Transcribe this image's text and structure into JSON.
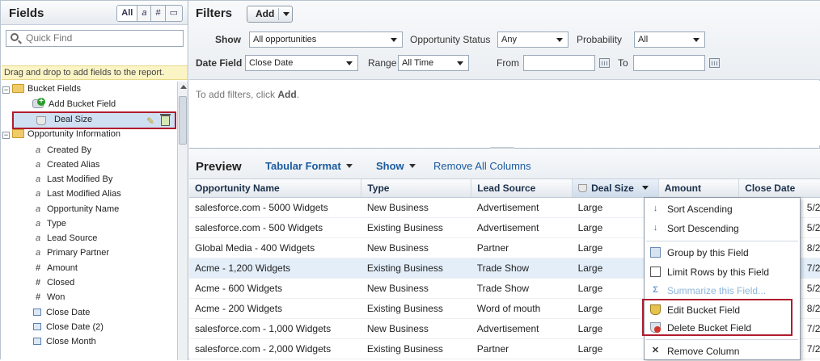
{
  "fields_panel": {
    "title": "Fields",
    "type_filters": [
      "All",
      "a",
      "#",
      "▭"
    ],
    "search_placeholder": "Quick Find",
    "tip": "Drag and drop to add fields to the report.",
    "tree": [
      {
        "kind": "folder",
        "label": "Bucket Fields",
        "level": 0
      },
      {
        "kind": "addbucket",
        "label": "Add Bucket Field",
        "level": 1
      },
      {
        "kind": "bucket",
        "label": "Deal Size",
        "level": 1,
        "selected": true
      },
      {
        "kind": "folder",
        "label": "Opportunity Information",
        "level": 0
      },
      {
        "kind": "text",
        "label": "Created By"
      },
      {
        "kind": "text",
        "label": "Created Alias"
      },
      {
        "kind": "text",
        "label": "Last Modified By"
      },
      {
        "kind": "text",
        "label": "Last Modified Alias"
      },
      {
        "kind": "text",
        "label": "Opportunity Name"
      },
      {
        "kind": "text",
        "label": "Type"
      },
      {
        "kind": "text",
        "label": "Lead Source"
      },
      {
        "kind": "text",
        "label": "Primary Partner"
      },
      {
        "kind": "num",
        "label": "Amount"
      },
      {
        "kind": "num",
        "label": "Closed"
      },
      {
        "kind": "num",
        "label": "Won"
      },
      {
        "kind": "date",
        "label": "Close Date"
      },
      {
        "kind": "date",
        "label": "Close Date (2)"
      },
      {
        "kind": "date",
        "label": "Close Month"
      }
    ]
  },
  "filters": {
    "title": "Filters",
    "add_label": "Add",
    "show_label": "Show",
    "show_value": "All opportunities",
    "status_label": "Opportunity Status",
    "status_value": "Any",
    "probability_label": "Probability",
    "probability_value": "All",
    "date_field_label": "Date Field",
    "date_field_value": "Close Date",
    "range_label": "Range",
    "range_value": "All Time",
    "from_label": "From",
    "to_label": "To",
    "hint_prefix": "To add filters, click ",
    "hint_bold": "Add",
    "hint_suffix": "."
  },
  "preview": {
    "title": "Preview",
    "format_label": "Tabular Format",
    "show_label": "Show",
    "remove_all_label": "Remove All Columns",
    "columns": [
      "Opportunity Name",
      "Type",
      "Lead Source",
      "Deal Size",
      "Amount",
      "Close Date"
    ],
    "rows": [
      [
        "salesforce.com - 5000 Widgets",
        "New Business",
        "Advertisement",
        "Large",
        "",
        "5/2"
      ],
      [
        "salesforce.com - 500 Widgets",
        "Existing Business",
        "Advertisement",
        "Large",
        "",
        "5/2"
      ],
      [
        "Global Media - 400 Widgets",
        "New Business",
        "Partner",
        "Large",
        "",
        "8/2"
      ],
      [
        "Acme - 1,200 Widgets",
        "Existing Business",
        "Trade Show",
        "Large",
        "",
        "7/2"
      ],
      [
        "Acme - 600 Widgets",
        "New Business",
        "Trade Show",
        "Large",
        "",
        "5/2"
      ],
      [
        "Acme - 200 Widgets",
        "Existing Business",
        "Word of mouth",
        "Large",
        "",
        "8/2"
      ],
      [
        "salesforce.com - 1,000 Widgets",
        "New Business",
        "Advertisement",
        "Large",
        "",
        "7/2"
      ],
      [
        "salesforce.com - 2,000 Widgets",
        "Existing Business",
        "Partner",
        "Large",
        "",
        "7/2"
      ]
    ]
  },
  "context_menu": {
    "items": [
      {
        "label": "Sort Ascending",
        "icon": "sort-ascending-icon"
      },
      {
        "label": "Sort Descending",
        "icon": "sort-descending-icon"
      },
      {
        "label": "Group by this Field",
        "icon": "group-icon"
      },
      {
        "label": "Limit Rows by this Field",
        "icon": "limit-rows-icon"
      },
      {
        "label": "Summarize this Field...",
        "icon": "sum-icon",
        "disabled": true
      },
      {
        "label": "Edit Bucket Field",
        "icon": "edit-bucket-icon"
      },
      {
        "label": "Delete Bucket Field",
        "icon": "delete-bucket-icon"
      },
      {
        "label": "Remove Column",
        "icon": "close-icon"
      }
    ]
  }
}
